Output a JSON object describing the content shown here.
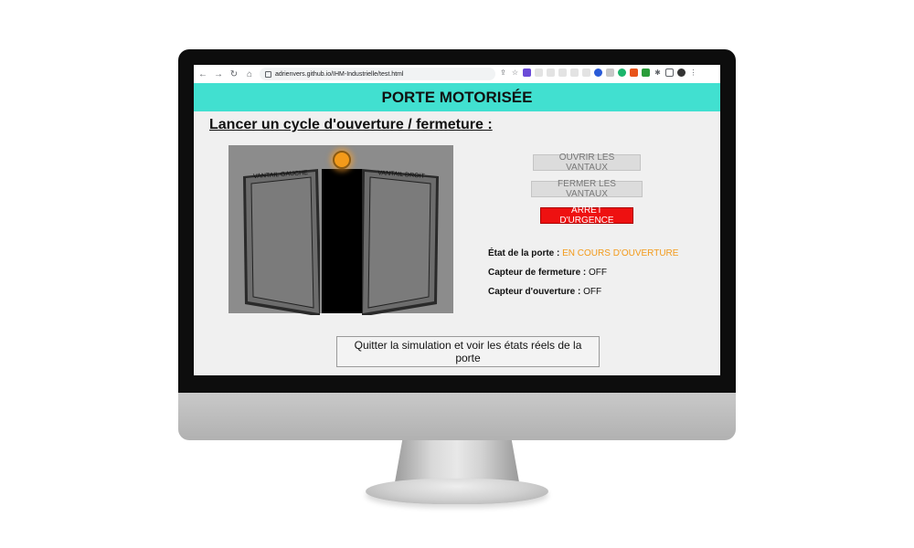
{
  "browser": {
    "url": "adrienvers.github.io/IHM-Industrielle/test.html",
    "nav": {
      "back": "←",
      "forward": "→",
      "reload": "↻",
      "home": "⌂"
    }
  },
  "page": {
    "title": "PORTE MOTORISÉE",
    "section_title": "Lancer un cycle d'ouverture / fermeture :"
  },
  "door": {
    "left_leaf_label": "VANTAIL GAUCHE",
    "right_leaf_label": "VANTAIL DROIT",
    "indicator_color": "#f39a1a"
  },
  "controls": {
    "open_label": "OUVRIR LES VANTAUX",
    "close_label": "FERMER LES VANTAUX",
    "emergency_label": "ARRÊT D'URGENCE"
  },
  "status": {
    "door_state_label": "État de la porte :",
    "door_state_value": "EN COURS D'OUVERTURE",
    "closing_sensor_label": "Capteur de fermeture :",
    "closing_sensor_value": "OFF",
    "opening_sensor_label": "Capteur d'ouverture :",
    "opening_sensor_value": "OFF"
  },
  "quit_label": "Quitter la simulation et voir les états réels de la porte",
  "colors": {
    "header": "#41e0d0",
    "emergency": "#ee1111",
    "state": "#f39a1a"
  }
}
